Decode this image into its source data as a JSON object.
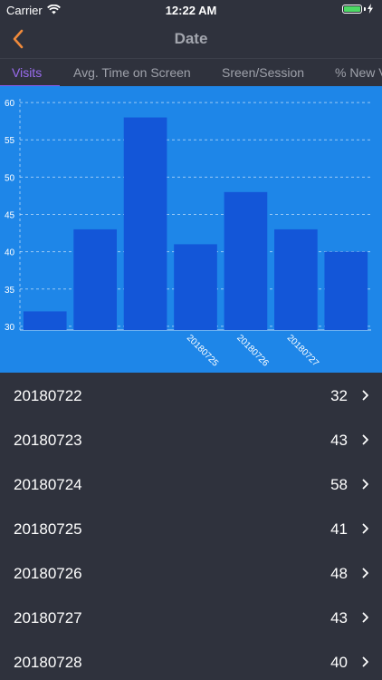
{
  "status_bar": {
    "carrier": "Carrier",
    "time": "12:22 AM",
    "wifi_icon": "wifi-icon",
    "battery_icon": "battery-icon",
    "battery_level": 1.0
  },
  "nav": {
    "title": "Date",
    "back_icon": "chevron-left-icon"
  },
  "tabs": [
    {
      "label": "Visits"
    },
    {
      "label": "Avg. Time on Screen"
    },
    {
      "label": "Sreen/Session"
    },
    {
      "label": "% New V"
    }
  ],
  "colors": {
    "accent_orange": "#f08a3b",
    "tab_active": "#9b6cf0",
    "chart_bg": "#1e86e8",
    "bar_fill": "#1356d8",
    "page_bg": "#2f323d"
  },
  "chart_data": {
    "type": "bar",
    "categories": [
      "20180722",
      "20180723",
      "20180724",
      "20180725",
      "20180726",
      "20180727",
      "20180728"
    ],
    "values": [
      32,
      43,
      58,
      41,
      48,
      43,
      40
    ],
    "x_tick_labels": [
      "",
      "",
      "",
      "20180725",
      "20180726",
      "20180727",
      ""
    ],
    "y_ticks": [
      30,
      35,
      40,
      45,
      50,
      55,
      60
    ],
    "ylim": [
      29.5,
      60.5
    ],
    "grid": true
  },
  "list": [
    {
      "label": "20180722",
      "value": "32"
    },
    {
      "label": "20180723",
      "value": "43"
    },
    {
      "label": "20180724",
      "value": "58"
    },
    {
      "label": "20180725",
      "value": "41"
    },
    {
      "label": "20180726",
      "value": "48"
    },
    {
      "label": "20180727",
      "value": "43"
    },
    {
      "label": "20180728",
      "value": "40"
    }
  ]
}
